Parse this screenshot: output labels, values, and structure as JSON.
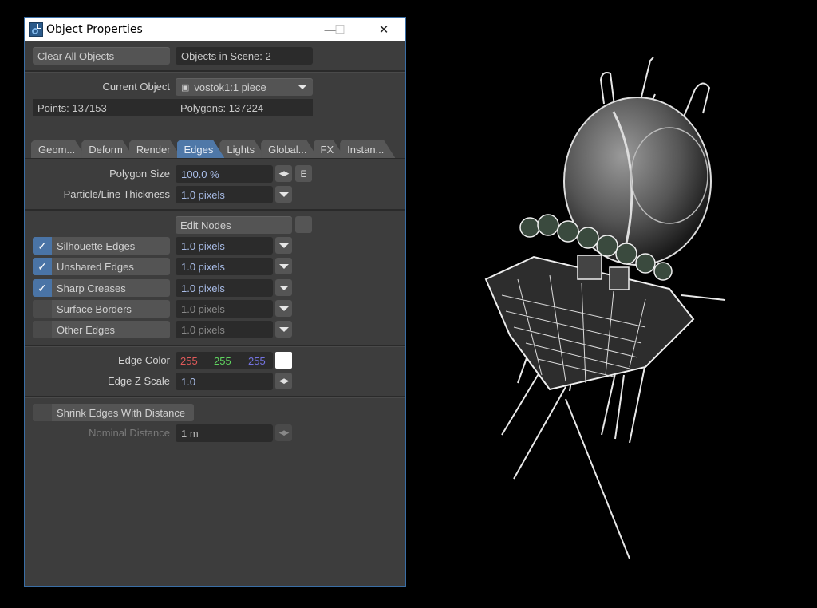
{
  "window": {
    "title": "Object Properties",
    "controls": {
      "minimize": "—",
      "maximize": "☐",
      "close": "✕"
    }
  },
  "top": {
    "clear_all_label": "Clear All Objects",
    "objects_in_scene": "Objects in Scene: 2"
  },
  "object": {
    "current_label": "Current Object",
    "current_value": "vostok1:1 piece",
    "points": "Points: 137153",
    "polygons": "Polygons: 137224"
  },
  "tabs": [
    {
      "label": "Geom...",
      "active": false
    },
    {
      "label": "Deform",
      "active": false
    },
    {
      "label": "Render",
      "active": false
    },
    {
      "label": "Edges",
      "active": true
    },
    {
      "label": "Lights",
      "active": false
    },
    {
      "label": "Global...",
      "active": false
    },
    {
      "label": "FX",
      "active": false
    },
    {
      "label": "Instan...",
      "active": false
    }
  ],
  "edges": {
    "polygon_size_label": "Polygon Size",
    "polygon_size_value": "100.0 %",
    "envelope_button": "E",
    "thickness_label": "Particle/Line Thickness",
    "thickness_value": "1.0 pixels",
    "edit_nodes_label": "Edit Nodes",
    "edge_types": [
      {
        "label": "Silhouette Edges",
        "checked": true,
        "value": "1.0 pixels"
      },
      {
        "label": "Unshared Edges",
        "checked": true,
        "value": "1.0 pixels"
      },
      {
        "label": "Sharp Creases",
        "checked": true,
        "value": "1.0 pixels"
      },
      {
        "label": "Surface Borders",
        "checked": false,
        "value": "1.0 pixels"
      },
      {
        "label": "Other Edges",
        "checked": false,
        "value": "1.0 pixels"
      }
    ],
    "edge_color_label": "Edge Color",
    "edge_color": {
      "r": "255",
      "g": "255",
      "b": "255",
      "swatch": "#ffffff"
    },
    "edge_z_scale_label": "Edge Z Scale",
    "edge_z_scale_value": "1.0",
    "shrink_label": "Shrink Edges With Distance",
    "shrink_checked": false,
    "nominal_distance_label": "Nominal Distance",
    "nominal_distance_value": "1 m"
  },
  "icons": {
    "check": "✓",
    "lr_arrows": "◀▶",
    "object": "▣"
  },
  "viewport": {
    "description": "Vostok 1 spacecraft rendered with white edge lines on black"
  }
}
